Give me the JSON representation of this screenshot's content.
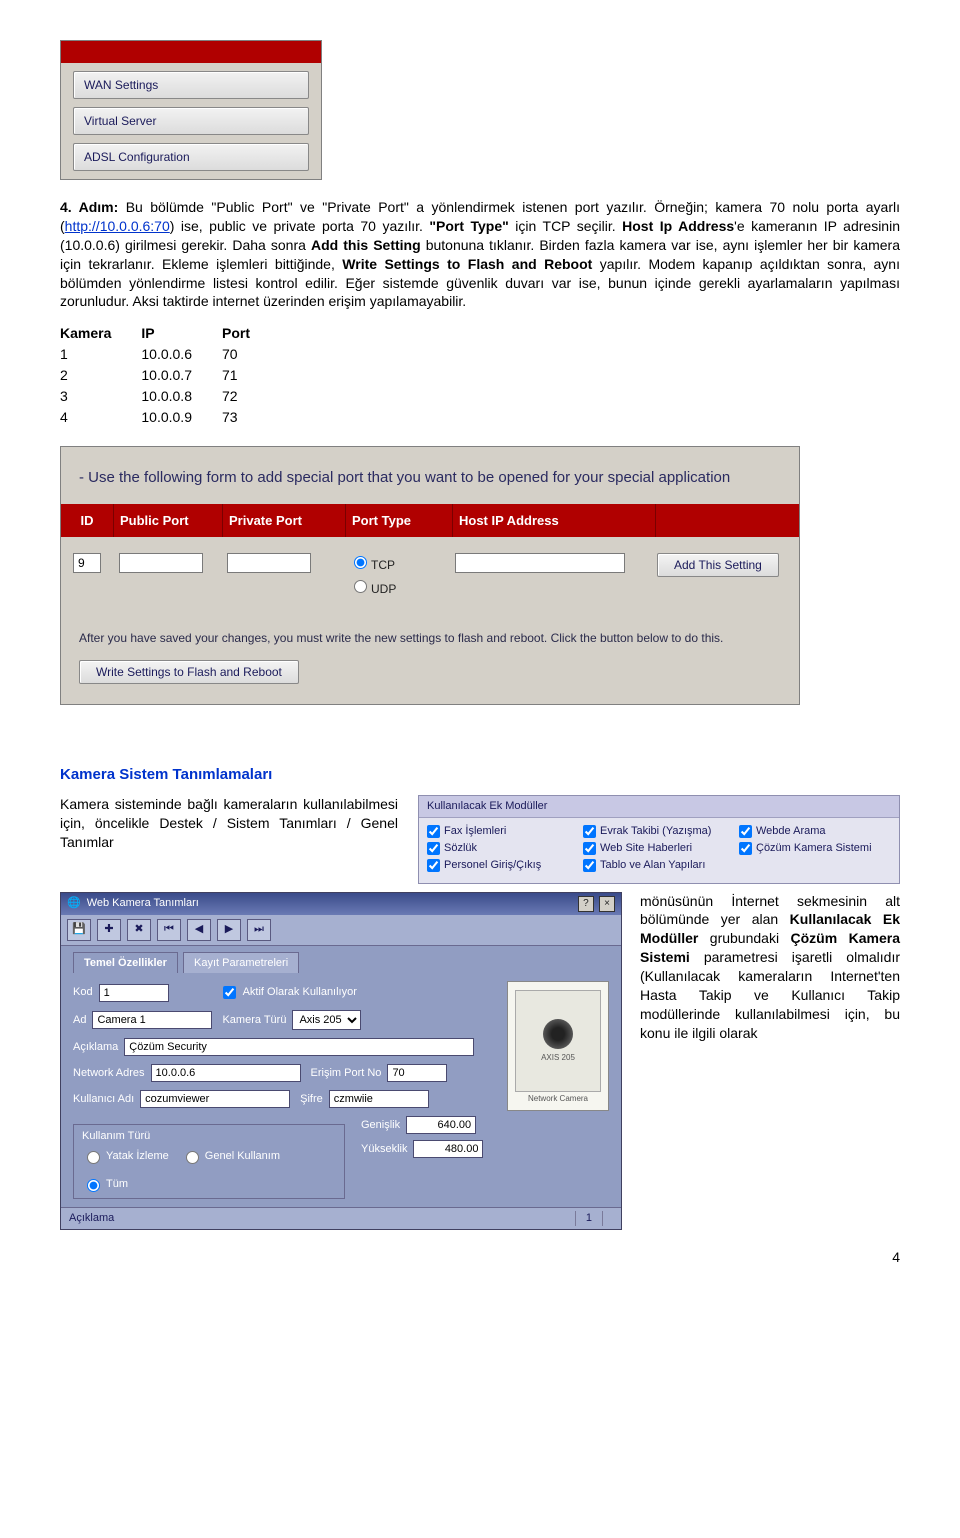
{
  "menu": {
    "items": [
      "WAN Settings",
      "Virtual Server",
      "ADSL Configuration"
    ]
  },
  "para1": {
    "lead": "4. Adım:",
    "t1": " Bu bölümde \"Public Port\" ve \"Private Port\" a yönlendirmek istenen port yazılır. Örneğin; kamera 70 nolu porta ayarlı (",
    "link": "http://10.0.0.6:70",
    "t2": ") ise, public ve private porta 70 yazılır. ",
    "b2": "\"Port Type\"",
    "t3": " için TCP seçilir. ",
    "b3": "Host Ip Address",
    "t4": "'e kameranın IP adresinin (10.0.0.6) girilmesi gerekir. Daha sonra ",
    "b4": "Add this Setting",
    "t5": " butonuna tıklanır. Birden fazla kamera var ise, aynı işlemler her bir kamera için tekrarlanır. Ekleme işlemleri bittiğinde, ",
    "b5": "Write Settings to Flash and Reboot",
    "t6": " yapılır. Modem kapanıp açıldıktan sonra, aynı bölümden yönlendirme listesi kontrol edilir. Eğer sistemde güvenlik duvarı var ise, bunun içinde gerekli ayarlamaların yapılması zorunludur. Aksi taktirde internet üzerinden erişim yapılamayabilir."
  },
  "camera_table": {
    "headers": [
      "Kamera",
      "IP",
      "Port"
    ],
    "rows": [
      [
        "1",
        "10.0.0.6",
        "70"
      ],
      [
        "2",
        "10.0.0.7",
        "71"
      ],
      [
        "3",
        "10.0.0.8",
        "72"
      ],
      [
        "4",
        "10.0.0.9",
        "73"
      ]
    ]
  },
  "vs": {
    "hint": "- Use the following form to add special port that you want to be opened for your special application",
    "cols": [
      "ID",
      "Public Port",
      "Private Port",
      "Port Type",
      "Host IP Address",
      ""
    ],
    "row": {
      "id": "9",
      "pub": "",
      "priv": "",
      "tcp": "TCP",
      "udp": "UDP",
      "host": "",
      "add": "Add This Setting"
    },
    "footer": "After you have saved your changes, you must write the new settings to flash and reboot. Click the button below to do this.",
    "save_btn": "Write Settings to Flash and Reboot"
  },
  "section2": {
    "heading": "Kamera Sistem Tanımlamaları",
    "left_text": "Kamera sisteminde bağlı kameraların kullanılabilmesi için, öncelikle Destek / Sistem Tanımları / Genel Tanımlar",
    "mods": {
      "title": "Kullanılacak Ek Modüller",
      "items": [
        "Fax İşlemleri",
        "Evrak Takibi (Yazışma)",
        "Webde Arama",
        "Sözlük",
        "Web Site Haberleri",
        "Çözüm Kamera Sistemi",
        "Personel Giriş/Çıkış",
        "Tablo ve Alan Yapıları",
        ""
      ]
    }
  },
  "wk": {
    "title": "Web Kamera Tanımları",
    "toolbar_icons": [
      "save-icon",
      "new-icon",
      "delete-icon",
      "nav-first-icon",
      "nav-prev-icon",
      "nav-next-icon",
      "nav-last-icon"
    ],
    "tabs": [
      "Temel Özellikler",
      "Kayıt Parametreleri"
    ],
    "fields": {
      "kod_lbl": "Kod",
      "kod": "1",
      "aktif_lbl": "Aktif Olarak Kullanılıyor",
      "ad_lbl": "Ad",
      "ad": "Camera 1",
      "turu_lbl": "Kamera Türü",
      "turu": "Axis 205",
      "aciklama_lbl": "Açıklama",
      "aciklama": "Çözüm Security",
      "naddr_lbl": "Network Adres",
      "naddr": "10.0.0.6",
      "port_lbl": "Erişim Port No",
      "port": "70",
      "user_lbl": "Kullanıcı Adı",
      "user": "cozumviewer",
      "pass_lbl": "Şifre",
      "pass": "czmwiie",
      "gen_lbl": "Genişlik",
      "gen": "640.00",
      "yuk_lbl": "Yükseklik",
      "yuk": "480.00"
    },
    "kullanim": {
      "title": "Kullanım Türü",
      "opts": [
        "Yatak İzleme",
        "Genel Kullanım",
        "Tüm"
      ]
    },
    "preview": {
      "brand": "AXIS 205",
      "sub": "Network Camera"
    },
    "status": {
      "label": "Açıklama",
      "count": "1"
    }
  },
  "right_text": {
    "t1": "mönüsünün İnternet sekmesinin alt bölümünde yer alan ",
    "b1": "Kullanılacak Ek Modüller",
    "t2": " grubundaki ",
    "b2": "Çözüm Kamera Sistemi",
    "t3": " parametresi işaretli olmalıdır (Kullanılacak kameraların Internet'ten Hasta Takip ve Kullanıcı Takip modüllerinde kullanılabilmesi için, bu konu ile ilgili olarak"
  },
  "page": "4"
}
